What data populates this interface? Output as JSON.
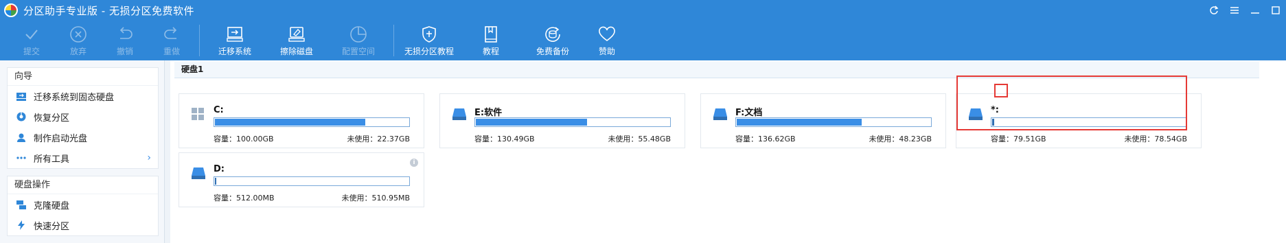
{
  "window": {
    "title": "分区助手专业版 - 无损分区免费软件",
    "controls": [
      "refresh-icon",
      "menu-icon",
      "minimize-icon",
      "maximize-icon"
    ]
  },
  "toolbar": {
    "items": [
      {
        "label": "提交",
        "icon": "check-icon",
        "enabled": false
      },
      {
        "label": "放弃",
        "icon": "cancel-icon",
        "enabled": false
      },
      {
        "label": "撤销",
        "icon": "undo-icon",
        "enabled": false
      },
      {
        "label": "重做",
        "icon": "redo-icon",
        "enabled": false
      },
      {
        "label": "迁移系统",
        "icon": "migrate-os-icon",
        "enabled": true
      },
      {
        "label": "擦除磁盘",
        "icon": "wipe-disk-icon",
        "enabled": true
      },
      {
        "label": "配置空间",
        "icon": "allocate-space-icon",
        "enabled": false
      },
      {
        "label": "无损分区教程",
        "icon": "shield-icon",
        "enabled": true
      },
      {
        "label": "教程",
        "icon": "book-icon",
        "enabled": true
      },
      {
        "label": "免费备份",
        "icon": "backup-icon",
        "enabled": true
      },
      {
        "label": "赞助",
        "icon": "heart-icon",
        "enabled": true
      }
    ]
  },
  "sidebar": {
    "wizard": {
      "heading": "向导",
      "items": [
        {
          "label": "迁移系统到固态硬盘",
          "icon": "ssd-migrate-icon"
        },
        {
          "label": "恢复分区",
          "icon": "recover-partition-icon"
        },
        {
          "label": "制作启动光盘",
          "icon": "boot-disc-icon"
        },
        {
          "label": "所有工具",
          "icon": "more-dots-icon",
          "chevron": "›"
        }
      ]
    },
    "disk_ops": {
      "heading": "硬盘操作",
      "items": [
        {
          "label": "克隆硬盘",
          "icon": "clone-disk-icon"
        },
        {
          "label": "快速分区",
          "icon": "lightning-icon"
        }
      ]
    }
  },
  "main": {
    "disk_header": "硬盘1",
    "partitions": [
      {
        "name": "C:",
        "icon": "windows-icon",
        "capacity": "容量：100.00GB",
        "unused": "未使用：22.37GB",
        "used_fraction": 0.776,
        "highlighted": false
      },
      {
        "name": "E:软件",
        "icon": "drive-icon",
        "capacity": "容量：130.49GB",
        "unused": "未使用：55.48GB",
        "used_fraction": 0.575,
        "highlighted": false
      },
      {
        "name": "F:文档",
        "icon": "drive-icon",
        "capacity": "容量：136.62GB",
        "unused": "未使用：48.23GB",
        "used_fraction": 0.647,
        "highlighted": false
      },
      {
        "name": "*:",
        "icon": "drive-icon",
        "capacity": "容量：79.51GB",
        "unused": "未使用：78.54GB",
        "used_fraction": 0.012,
        "highlighted": true
      },
      {
        "name": "D:",
        "icon": "drive-icon",
        "capacity": "容量：512.00MB",
        "unused": "未使用：510.95MB",
        "used_fraction": 0.002,
        "highlighted": false,
        "info_icon": "info-icon"
      }
    ]
  },
  "colors": {
    "brand": "#2f87d8",
    "bar_fill": "#3a8ee6",
    "highlight": "#e53935"
  }
}
